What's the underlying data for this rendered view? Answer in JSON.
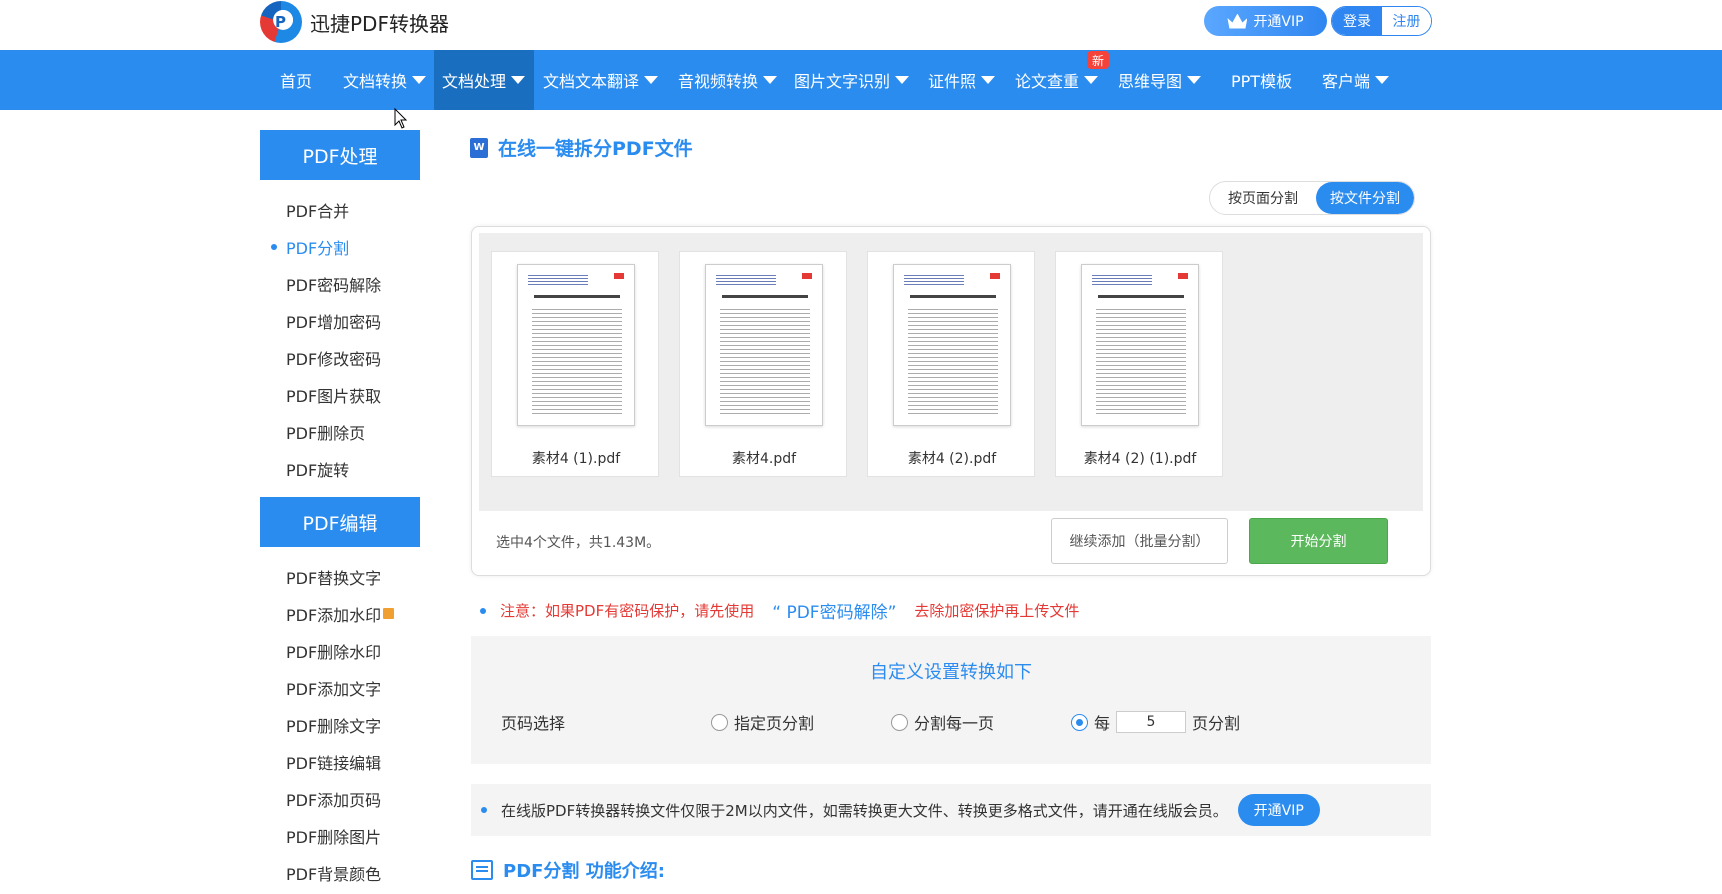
{
  "header": {
    "brand": "迅捷PDF转换器",
    "vip_label": "开通VIP",
    "login_label": "登录",
    "register_label": "注册"
  },
  "nav": {
    "items": [
      {
        "label": "首页"
      },
      {
        "label": "文档转换"
      },
      {
        "label": "文档处理"
      },
      {
        "label": "文档文本翻译"
      },
      {
        "label": "音视频转换"
      },
      {
        "label": "图片文字识别"
      },
      {
        "label": "证件照"
      },
      {
        "label": "论文查重"
      },
      {
        "label": "思维导图"
      },
      {
        "label": "PPT模板"
      },
      {
        "label": "客户端"
      }
    ],
    "new_badge": "新"
  },
  "sidebar": {
    "section1_title": "PDF处理",
    "section1_items": [
      "PDF合并",
      "PDF分割",
      "PDF密码解除",
      "PDF增加密码",
      "PDF修改密码",
      "PDF图片获取",
      "PDF删除页",
      "PDF旋转"
    ],
    "section2_title": "PDF编辑",
    "section2_items": [
      "PDF替换文字",
      "PDF添加水印",
      "PDF删除水印",
      "PDF添加文字",
      "PDF删除文字",
      "PDF链接编辑",
      "PDF添加页码",
      "PDF删除图片",
      "PDF背景颜色"
    ]
  },
  "main": {
    "title": "在线一键拆分PDF文件",
    "segment": {
      "by_page": "按页面分割",
      "by_file": "按文件分割"
    },
    "files": [
      "素材4 (1).pdf",
      "素材4.pdf",
      "素材4 (2).pdf",
      "素材4 (2) (1).pdf"
    ],
    "selection_info": "选中4个文件，共1.43M。",
    "add_button": "继续添加（批量分割）",
    "start_button": "开始分割",
    "notice_prefix": "注意：如果PDF有密码保护，请先使用",
    "notice_link": "“ PDF密码解除”",
    "notice_suffix": "去除加密保护再上传文件",
    "settings": {
      "title": "自定义设置转换如下",
      "label": "页码选择",
      "opt1": "指定页分割",
      "opt2": "分割每一页",
      "opt3_prefix": "每",
      "opt3_value": "5",
      "opt3_suffix": "页分割"
    },
    "tip_text": "在线版PDF转换器转换文件仅限于2M以内文件，如需转换更大文件、转换更多格式文件，请开通在线版会员。",
    "tip_vip": "开通VIP",
    "intro_title": "PDF分割 功能介绍:"
  },
  "colors": {
    "accent": "#2b8cf0",
    "nav_active": "#1a6ec0",
    "start_green": "#5cb85c",
    "notice_red": "#e53935"
  }
}
